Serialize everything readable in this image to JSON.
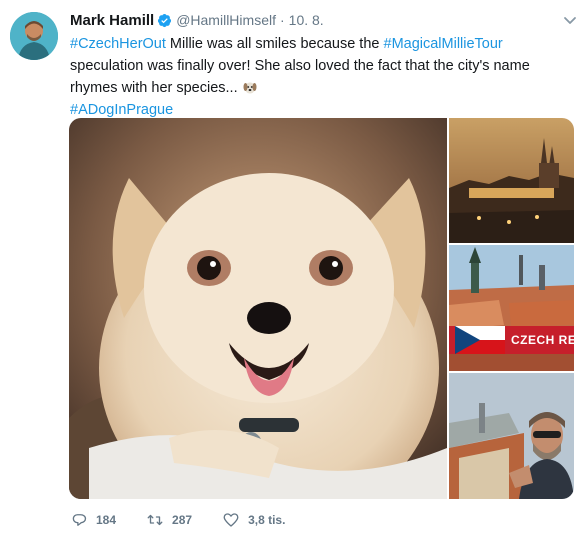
{
  "tweet": {
    "author_name": "Mark Hamill",
    "handle": "@HamillHimself",
    "separator": "·",
    "date": "10. 8.",
    "text": {
      "tag1": "#CzechHerOut",
      "part1": " Millie was all smiles because the ",
      "tag2": "#MagicalMillieTour",
      "part2": " speculation was finally over! She also loved the fact that the city's name rhymes with her species...",
      "tag3": "#ADogInPrague"
    },
    "media": {
      "banner_text": "CZECH RE"
    },
    "actions": {
      "replies": "184",
      "retweets": "287",
      "likes": "3,8 tis."
    }
  },
  "colors": {
    "link": "#1b95e0",
    "secondary_text": "#657786",
    "verified": "#1da1f2"
  },
  "icons": [
    "verified-badge-icon",
    "chevron-down-icon",
    "dog-emoji-icon",
    "reply-icon",
    "retweet-icon",
    "like-icon"
  ]
}
